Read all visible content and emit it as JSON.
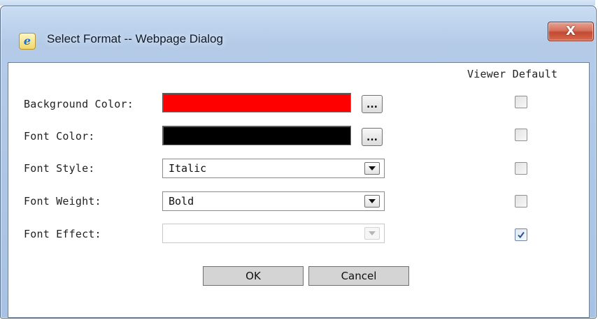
{
  "window": {
    "title": "Select Format -- Webpage Dialog",
    "close_label": "X",
    "icon": "internet-explorer-icon"
  },
  "dialog": {
    "header_label": "Viewer Default",
    "rows": [
      {
        "label": "Background Color:",
        "type": "color",
        "value_color": "#ff0000",
        "viewer_default": false
      },
      {
        "label": "Font Color:",
        "type": "color",
        "value_color": "#000000",
        "viewer_default": false
      },
      {
        "label": "Font Style:",
        "type": "select",
        "value": "Italic",
        "viewer_default": false
      },
      {
        "label": "Font Weight:",
        "type": "select",
        "value": "Bold",
        "viewer_default": false
      },
      {
        "label": "Font Effect:",
        "type": "select",
        "value": "",
        "disabled": true,
        "viewer_default": true
      }
    ],
    "picker_button_label": "...",
    "ok_label": "OK",
    "cancel_label": "Cancel"
  }
}
